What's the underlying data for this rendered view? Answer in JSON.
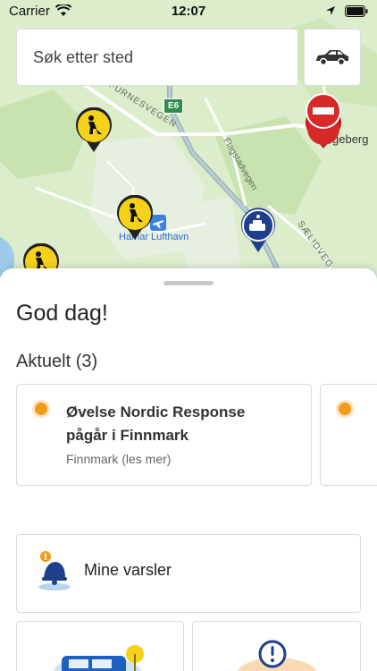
{
  "status_bar": {
    "carrier": "Carrier",
    "time": "12:07"
  },
  "search": {
    "placeholder": "Søk etter sted"
  },
  "map": {
    "road_furnesvegen": "FURNESVEGEN",
    "road_flagstadvegen": "Flagstadvegen",
    "road_saelidvegen": "SÆLIDVEG",
    "road_number": "E6",
    "airport": "Hamar Lufthavn",
    "place_partial": "geberg"
  },
  "sheet": {
    "greeting": "God dag!",
    "current_heading": "Aktuelt (3)",
    "news": [
      {
        "title": "Øvelse Nordic Response pågår i Finnmark",
        "subtitle": "Finnmark (les mer)"
      }
    ],
    "alerts_label": "Mine varsler"
  },
  "colors": {
    "accent_orange": "#f39a1a",
    "roadwork_yellow": "#f6d11a",
    "danger_red": "#d62a2a",
    "navy": "#1f3e8c"
  }
}
